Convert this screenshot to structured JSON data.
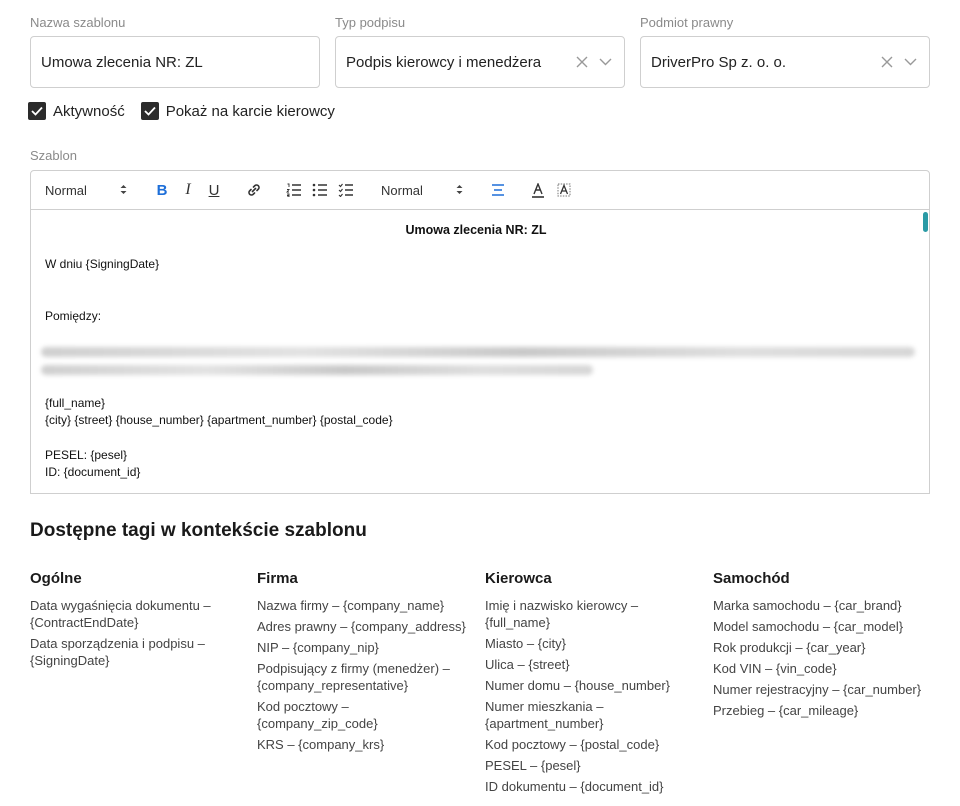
{
  "form": {
    "template_name": {
      "label": "Nazwa szablonu",
      "value": "Umowa zlecenia NR: ZL"
    },
    "signature_type": {
      "label": "Typ podpisu",
      "value": "Podpis kierowcy i menedżera"
    },
    "legal_entity": {
      "label": "Podmiot prawny",
      "value": "DriverPro Sp z. o. o."
    },
    "checkboxes": [
      {
        "label": "Aktywność",
        "checked": true
      },
      {
        "label": "Pokaż na karcie kierowcy",
        "checked": true
      }
    ]
  },
  "editor": {
    "label": "Szablon",
    "toolbar": {
      "style_select": "Normal",
      "size_select": "Normal",
      "bold": "B",
      "italic": "I",
      "underline": "U"
    },
    "content": {
      "title": "Umowa zlecenia NR: ZL",
      "line1": "W dniu {SigningDate}",
      "line2": "Pomiędzy:",
      "line3": "{full_name}",
      "line4": "{city} {street} {house_number} {apartment_number} {postal_code}",
      "line5": "PESEL: {pesel}",
      "line6": "ID: {document_id}"
    }
  },
  "tags": {
    "title": "Dostępne tagi w kontekście szablonu",
    "columns": [
      {
        "heading": "Ogólne",
        "items": [
          "Data wygaśnięcia dokumentu – {ContractEndDate}",
          "Data sporządzenia i podpisu – {SigningDate}"
        ]
      },
      {
        "heading": "Firma",
        "items": [
          "Nazwa firmy – {company_name}",
          "Adres prawny – {company_address}",
          "NIP – {company_nip}",
          "Podpisujący z firmy (menedżer) – {company_representative}",
          "Kod pocztowy – {company_zip_code}",
          "KRS – {company_krs}"
        ]
      },
      {
        "heading": "Kierowca",
        "items": [
          "Imię i nazwisko kierowcy – {full_name}",
          "Miasto – {city}",
          "Ulica – {street}",
          "Numer domu – {house_number}",
          "Numer mieszkania – {apartment_number}",
          "Kod pocztowy – {postal_code}",
          "PESEL – {pesel}",
          "ID dokumentu – {document_id}"
        ]
      },
      {
        "heading": "Samochód",
        "items": [
          "Marka samochodu – {car_brand}",
          "Model samochodu – {car_model}",
          "Rok produkcji – {car_year}",
          "Kod VIN – {vin_code}",
          "Numer rejestracyjny – {car_number}",
          "Przebieg – {car_mileage}"
        ]
      }
    ]
  }
}
